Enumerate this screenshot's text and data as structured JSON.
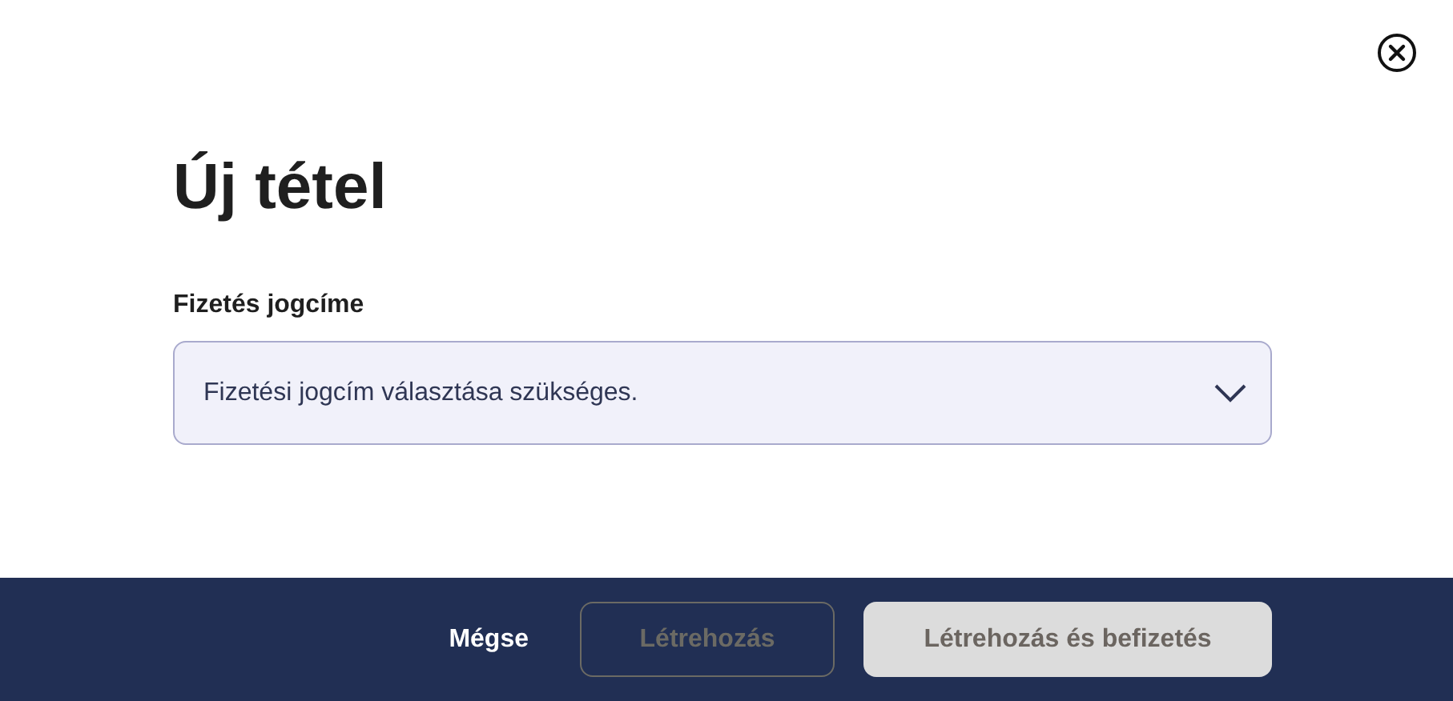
{
  "dialog": {
    "title": "Új tétel"
  },
  "field": {
    "label": "Fizetés jogcíme",
    "placeholder": "Fizetési jogcím választása szükséges."
  },
  "buttons": [
    {
      "label": "Mégse",
      "kind": "text",
      "disabled": false
    },
    {
      "label": "Létrehozás",
      "kind": "outline",
      "disabled": true
    },
    {
      "label": "Létrehozás és befizetés",
      "kind": "filled",
      "disabled": true
    }
  ]
}
